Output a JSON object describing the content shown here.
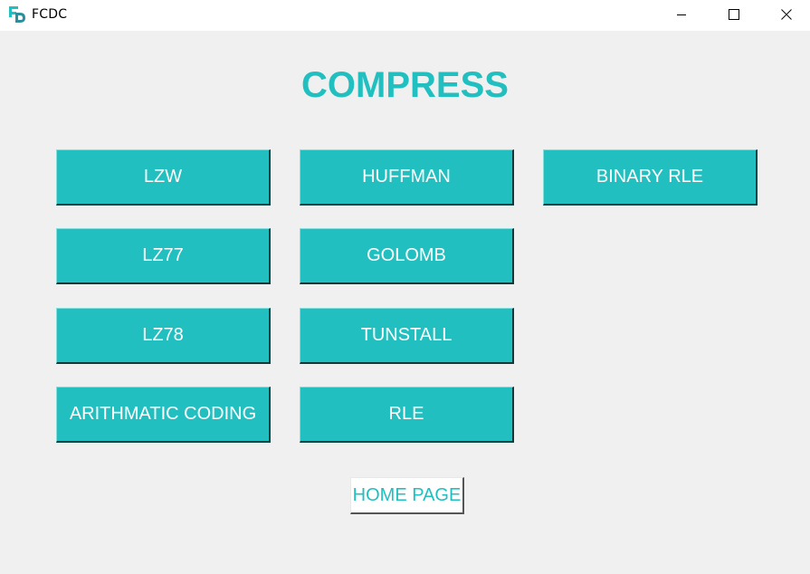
{
  "window": {
    "title": "FCDC",
    "icon": "fd-logo-icon"
  },
  "colors": {
    "accent": "#21bfbf",
    "background": "#f0f0f0",
    "button_text": "#ffffff"
  },
  "main": {
    "heading": "COMPRESS",
    "buttons": {
      "lzw": "LZW",
      "huffman": "HUFFMAN",
      "binary_rle": "BINARY RLE",
      "lz77": "LZ77",
      "golomb": "GOLOMB",
      "lz78": "LZ78",
      "tunstall": "TUNSTALL",
      "arithmatic_coding": "ARITHMATIC CODING",
      "rle": "RLE"
    },
    "home_button": "HOME PAGE"
  }
}
